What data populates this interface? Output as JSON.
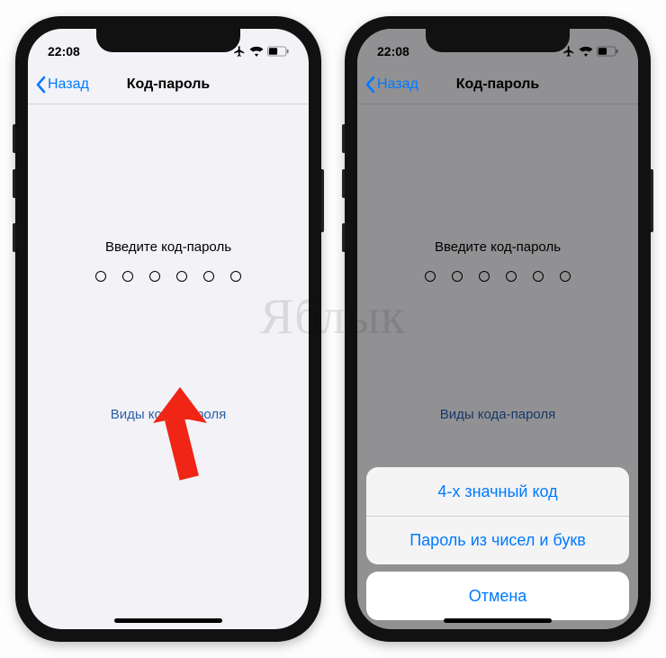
{
  "watermark": "Яблык",
  "left": {
    "statusbar": {
      "time": "22:08"
    },
    "nav": {
      "back": "Назад",
      "title": "Код-пароль"
    },
    "prompt": "Введите код-пароль",
    "options_link": "Виды кода-пароля",
    "passcode_dots": 6
  },
  "right": {
    "statusbar": {
      "time": "22:08"
    },
    "nav": {
      "back": "Назад",
      "title": "Код-пароль"
    },
    "prompt": "Введите код-пароль",
    "options_link": "Виды кода-пароля",
    "passcode_dots": 6,
    "sheet": {
      "opt1": "4-х значный код",
      "opt2": "Пароль из чисел и букв",
      "cancel": "Отмена"
    }
  },
  "colors": {
    "ios_blue": "#007aff",
    "link_blue": "#2a5fa8",
    "arrow_red": "#f02515"
  }
}
